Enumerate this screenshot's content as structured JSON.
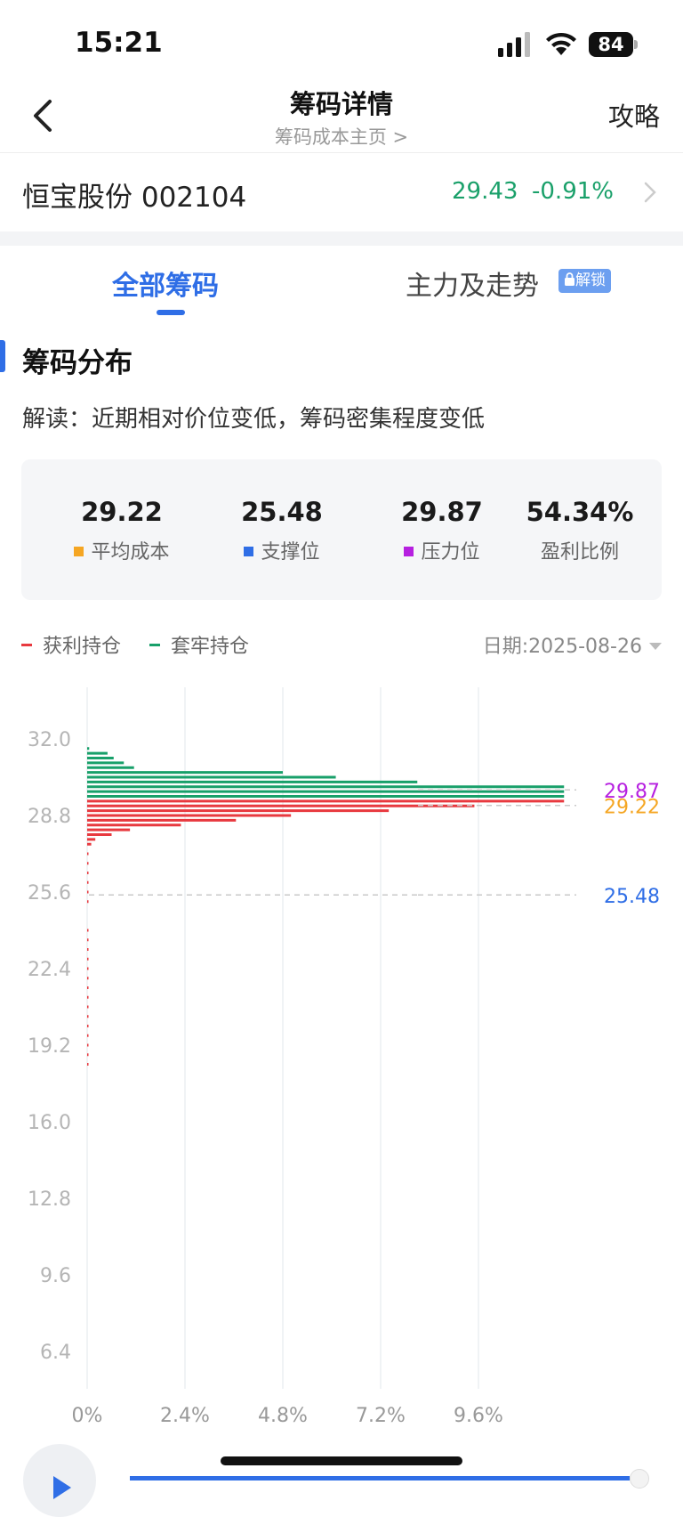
{
  "status": {
    "time": "15:21",
    "battery": "84"
  },
  "nav": {
    "title": "筹码详情",
    "subtitle": "筹码成本主页 >",
    "right": "攻略"
  },
  "stock": {
    "name": "恒宝股份 002104",
    "price": "29.43",
    "change": "-0.91%"
  },
  "tabs": [
    {
      "label": "全部筹码",
      "active": true
    },
    {
      "label": "主力及走势",
      "badge": "解锁"
    }
  ],
  "section": {
    "title": "筹码分布",
    "interpretation": "解读：近期相对价位变低，筹码密集程度变低"
  },
  "stats": [
    {
      "value": "29.22",
      "label": "平均成本",
      "color": "#f5a623"
    },
    {
      "value": "25.48",
      "label": "支撑位",
      "color": "#2f6ee6"
    },
    {
      "value": "29.87",
      "label": "压力位",
      "color": "#b620e0"
    },
    {
      "value": "54.34%",
      "label": "盈利比例",
      "color": ""
    }
  ],
  "legend": {
    "profit": "获利持仓",
    "trapped": "套牢持仓",
    "date": "日期:2025-08-26"
  },
  "colors": {
    "profit": "#e8393f",
    "trapped": "#18a06a",
    "accent": "#2f6ee6"
  },
  "chart_data": {
    "type": "bar",
    "orientation": "horizontal",
    "y_ticks": [
      "32.0",
      "28.8",
      "25.6",
      "22.4",
      "19.2",
      "16.0",
      "12.8",
      "9.6",
      "6.4"
    ],
    "x_ticks": [
      "0%",
      "2.4%",
      "4.8%",
      "7.2%",
      "9.6%"
    ],
    "ylim": [
      6.4,
      32.0
    ],
    "xlim": [
      0,
      12.0
    ],
    "reference_lines": [
      {
        "value": 29.87,
        "label": "29.87",
        "color": "#b620e0"
      },
      {
        "value": 29.22,
        "label": "29.22",
        "color": "#f5a623"
      },
      {
        "value": 25.48,
        "label": "25.48",
        "color": "#2f6ee6"
      }
    ],
    "series": [
      {
        "name": "套牢持仓",
        "color": "#18a06a",
        "points": [
          {
            "price": 31.6,
            "pct": 0.05
          },
          {
            "price": 31.4,
            "pct": 0.5
          },
          {
            "price": 31.2,
            "pct": 0.65
          },
          {
            "price": 31.0,
            "pct": 0.9
          },
          {
            "price": 30.8,
            "pct": 1.15
          },
          {
            "price": 30.6,
            "pct": 4.8
          },
          {
            "price": 30.4,
            "pct": 6.1
          },
          {
            "price": 30.2,
            "pct": 8.1
          },
          {
            "price": 30.0,
            "pct": 11.7
          },
          {
            "price": 29.8,
            "pct": 11.7
          },
          {
            "price": 29.6,
            "pct": 11.7
          }
        ]
      },
      {
        "name": "获利持仓",
        "color": "#e8393f",
        "points": [
          {
            "price": 29.4,
            "pct": 11.7
          },
          {
            "price": 29.2,
            "pct": 9.5
          },
          {
            "price": 29.0,
            "pct": 7.4
          },
          {
            "price": 28.8,
            "pct": 5.0
          },
          {
            "price": 28.6,
            "pct": 3.65
          },
          {
            "price": 28.4,
            "pct": 2.3
          },
          {
            "price": 28.2,
            "pct": 1.05
          },
          {
            "price": 28.0,
            "pct": 0.6
          },
          {
            "price": 27.8,
            "pct": 0.2
          },
          {
            "price": 27.6,
            "pct": 0.1
          },
          {
            "price": 27.2,
            "pct": 0.03
          },
          {
            "price": 26.8,
            "pct": 0.03
          },
          {
            "price": 26.4,
            "pct": 0.03
          },
          {
            "price": 26.0,
            "pct": 0.03
          },
          {
            "price": 25.6,
            "pct": 0.03
          },
          {
            "price": 25.2,
            "pct": 0.02
          },
          {
            "price": 24.0,
            "pct": 0.02
          },
          {
            "price": 23.6,
            "pct": 0.02
          },
          {
            "price": 23.2,
            "pct": 0.02
          },
          {
            "price": 22.8,
            "pct": 0.02
          },
          {
            "price": 22.4,
            "pct": 0.02
          },
          {
            "price": 22.0,
            "pct": 0.02
          },
          {
            "price": 21.6,
            "pct": 0.02
          },
          {
            "price": 21.2,
            "pct": 0.02
          },
          {
            "price": 20.8,
            "pct": 0.02
          },
          {
            "price": 20.4,
            "pct": 0.02
          },
          {
            "price": 20.0,
            "pct": 0.02
          },
          {
            "price": 19.6,
            "pct": 0.02
          },
          {
            "price": 19.2,
            "pct": 0.02
          },
          {
            "price": 18.8,
            "pct": 0.02
          },
          {
            "price": 18.4,
            "pct": 0.02
          }
        ]
      }
    ]
  }
}
